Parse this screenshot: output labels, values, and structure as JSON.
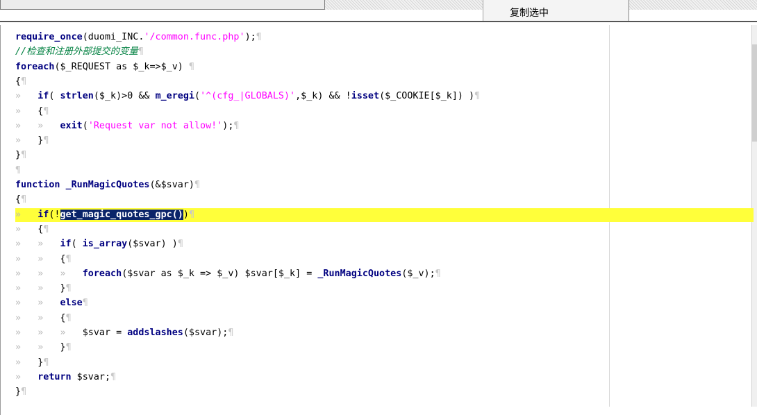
{
  "context_menu": {
    "copy_selection": "复制选中"
  },
  "code_lines": [
    {
      "parts": [
        [
          "kw",
          "require_once"
        ],
        [
          "t",
          "(duomi_INC."
        ],
        [
          "str",
          "'/common.func.php'"
        ],
        [
          "t",
          ");"
        ],
        [
          "pil",
          "¶"
        ]
      ]
    },
    {
      "parts": [
        [
          "cmt",
          "//检查和注册外部提交的变量"
        ],
        [
          "pil",
          "¶"
        ]
      ]
    },
    {
      "parts": [
        [
          "kw",
          "foreach"
        ],
        [
          "t",
          "($_REQUEST as $_k=>$_v)"
        ],
        [
          "pil",
          " ¶"
        ]
      ]
    },
    {
      "parts": [
        [
          "t",
          "{"
        ],
        [
          "pil",
          "¶"
        ]
      ]
    },
    {
      "parts": [
        [
          "ind",
          "»   "
        ],
        [
          "kw",
          "if"
        ],
        [
          "t",
          "( "
        ],
        [
          "fn",
          "strlen"
        ],
        [
          "t",
          "($_k)>0 && "
        ],
        [
          "fn",
          "m_eregi"
        ],
        [
          "t",
          "("
        ],
        [
          "str",
          "'^(cfg_|GLOBALS)'"
        ],
        [
          "t",
          ",$_k) && !"
        ],
        [
          "fn",
          "isset"
        ],
        [
          "t",
          "($_COOKIE[$_k]) )"
        ],
        [
          "pil",
          "¶"
        ]
      ]
    },
    {
      "parts": [
        [
          "ind",
          "»   "
        ],
        [
          "t",
          "{"
        ],
        [
          "pil",
          "¶"
        ]
      ]
    },
    {
      "parts": [
        [
          "ind",
          "»   »   "
        ],
        [
          "kw",
          "exit"
        ],
        [
          "t",
          "("
        ],
        [
          "str",
          "'Request var not allow!'"
        ],
        [
          "t",
          ");"
        ],
        [
          "pil",
          "¶"
        ]
      ]
    },
    {
      "parts": [
        [
          "ind",
          "»   "
        ],
        [
          "t",
          "}"
        ],
        [
          "pil",
          "¶"
        ]
      ]
    },
    {
      "parts": [
        [
          "t",
          "}"
        ],
        [
          "pil",
          "¶"
        ]
      ]
    },
    {
      "parts": [
        [
          "pil",
          "¶"
        ]
      ]
    },
    {
      "parts": [
        [
          "kw",
          "function"
        ],
        [
          "t",
          " "
        ],
        [
          "fn",
          "_RunMagicQuotes"
        ],
        [
          "t",
          "(&$svar)"
        ],
        [
          "pil",
          "¶"
        ]
      ]
    },
    {
      "parts": [
        [
          "t",
          "{"
        ],
        [
          "pil",
          "¶"
        ]
      ]
    },
    {
      "hl": true,
      "parts": [
        [
          "ind",
          "»   "
        ],
        [
          "kw",
          "if"
        ],
        [
          "t",
          "(!"
        ],
        [
          "sel",
          "get_magic_quotes_gpc()"
        ],
        [
          "t",
          ")"
        ],
        [
          "pil",
          "¶"
        ]
      ]
    },
    {
      "parts": [
        [
          "ind",
          "»   "
        ],
        [
          "t",
          "{"
        ],
        [
          "pil",
          "¶"
        ]
      ]
    },
    {
      "parts": [
        [
          "ind",
          "»   »   "
        ],
        [
          "kw",
          "if"
        ],
        [
          "t",
          "( "
        ],
        [
          "fn",
          "is_array"
        ],
        [
          "t",
          "($svar) )"
        ],
        [
          "pil",
          "¶"
        ]
      ]
    },
    {
      "parts": [
        [
          "ind",
          "»   »   "
        ],
        [
          "t",
          "{"
        ],
        [
          "pil",
          "¶"
        ]
      ]
    },
    {
      "parts": [
        [
          "ind",
          "»   »   »   "
        ],
        [
          "kw",
          "foreach"
        ],
        [
          "t",
          "($svar as $_k => $_v) $svar[$_k] = "
        ],
        [
          "fn",
          "_RunMagicQuotes"
        ],
        [
          "t",
          "($_v);"
        ],
        [
          "pil",
          "¶"
        ]
      ]
    },
    {
      "parts": [
        [
          "ind",
          "»   »   "
        ],
        [
          "t",
          "}"
        ],
        [
          "pil",
          "¶"
        ]
      ]
    },
    {
      "parts": [
        [
          "ind",
          "»   »   "
        ],
        [
          "kw",
          "else"
        ],
        [
          "pil",
          "¶"
        ]
      ]
    },
    {
      "parts": [
        [
          "ind",
          "»   »   "
        ],
        [
          "t",
          "{"
        ],
        [
          "pil",
          "¶"
        ]
      ]
    },
    {
      "parts": [
        [
          "ind",
          "»   »   »   "
        ],
        [
          "t",
          "$svar = "
        ],
        [
          "fn",
          "addslashes"
        ],
        [
          "t",
          "($svar);"
        ],
        [
          "pil",
          "¶"
        ]
      ]
    },
    {
      "parts": [
        [
          "ind",
          "»   »   "
        ],
        [
          "t",
          "}"
        ],
        [
          "pil",
          "¶"
        ]
      ]
    },
    {
      "parts": [
        [
          "ind",
          "»   "
        ],
        [
          "t",
          "}"
        ],
        [
          "pil",
          "¶"
        ]
      ]
    },
    {
      "parts": [
        [
          "ind",
          "»   "
        ],
        [
          "kw",
          "return"
        ],
        [
          "t",
          " $svar;"
        ],
        [
          "pil",
          "¶"
        ]
      ]
    },
    {
      "parts": [
        [
          "t",
          "}"
        ],
        [
          "pil",
          "¶"
        ]
      ]
    }
  ],
  "colors": {
    "keyword": "#000080",
    "string": "#ff00ff",
    "comment": "#008040",
    "current_line": "#ffff3a",
    "selection": "#0a246a"
  }
}
